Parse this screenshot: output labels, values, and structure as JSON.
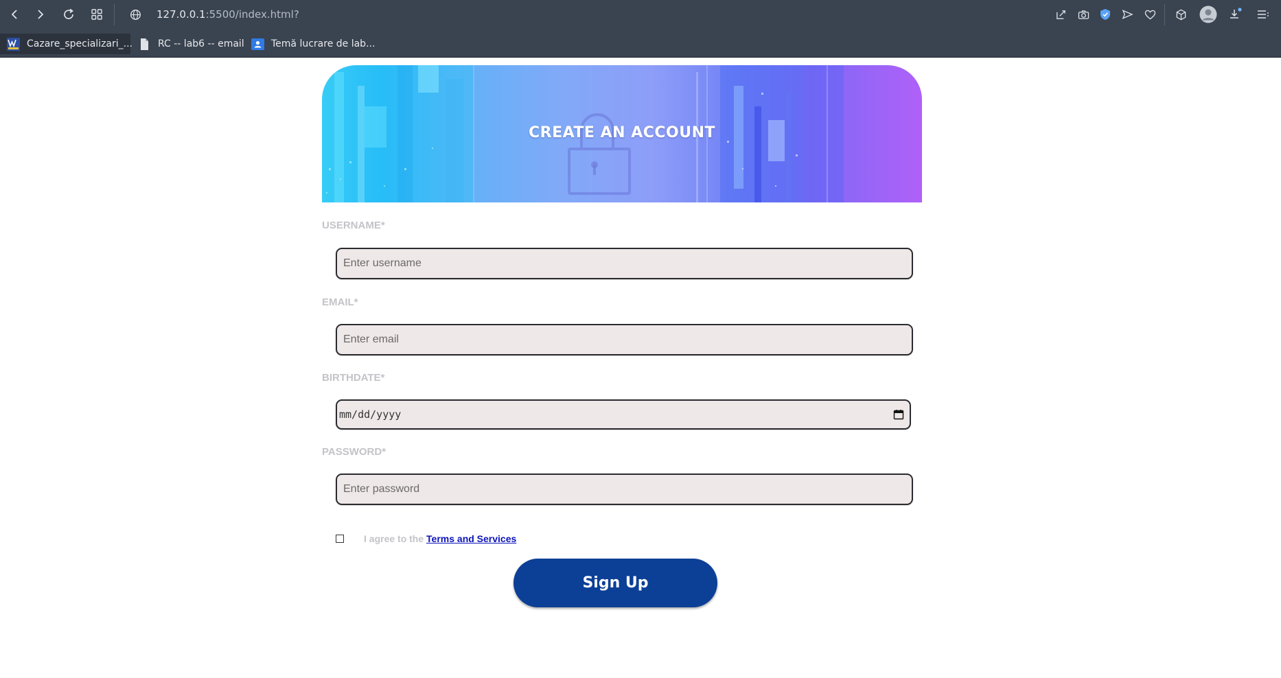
{
  "browser": {
    "url_host": "127.0.0.1",
    "url_rest": ":5500/index.html?",
    "bookmarks": [
      {
        "label": "Cazare_specializari_..."
      },
      {
        "label": "RC -- lab6 -- email"
      },
      {
        "label": "Temă lucrare de lab..."
      }
    ]
  },
  "form": {
    "title": "CREATE AN ACCOUNT",
    "username_label": "USERNAME*",
    "username_placeholder": "Enter username",
    "email_label": "EMAIL*",
    "email_placeholder": "Enter email",
    "birthdate_label": "BIRTHDATE*",
    "birthdate_placeholder": "mm/dd/yyyy",
    "password_label": "PASSWORD*",
    "password_placeholder": "Enter password",
    "agree_prefix": "I agree to the ",
    "terms_link": "Terms and Services",
    "agree_checked": false,
    "submit_label": "Sign Up"
  },
  "colors": {
    "chrome": "#3a4350",
    "button": "#0c3f96",
    "link": "#0b12b8",
    "label": "#c3c3c8",
    "input_bg": "#efe8e8"
  }
}
